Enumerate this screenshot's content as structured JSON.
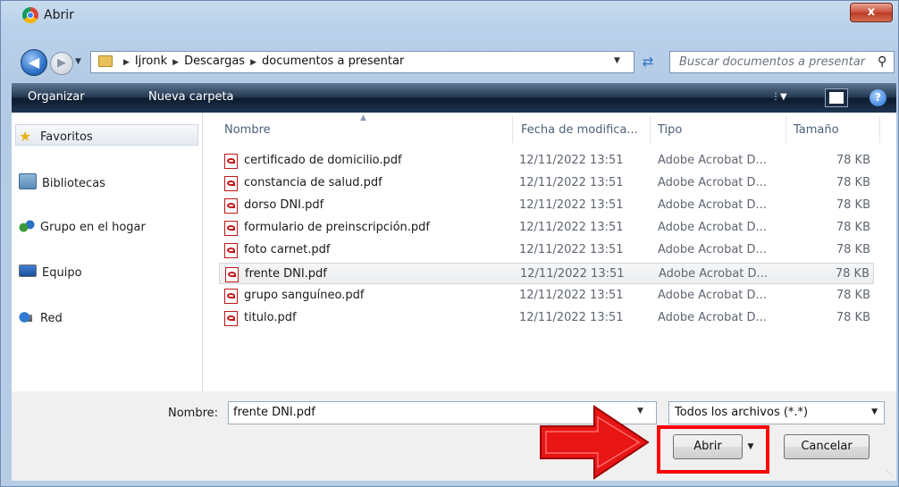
{
  "window": {
    "title": "Abrir",
    "close_label": "x"
  },
  "address": {
    "crumbs": [
      "Ijronk",
      "Descargas",
      "documentos a presentar"
    ],
    "search_placeholder": "Buscar documentos a presentar"
  },
  "toolbar": {
    "organize": "Organizar",
    "new_folder": "Nueva carpeta",
    "help": "?"
  },
  "sidebar": {
    "items": [
      {
        "label": "Favoritos",
        "icon": "star-icon"
      },
      {
        "label": "Bibliotecas",
        "icon": "library-icon"
      },
      {
        "label": "Grupo en el hogar",
        "icon": "homegroup-icon"
      },
      {
        "label": "Equipo",
        "icon": "computer-icon"
      },
      {
        "label": "Red",
        "icon": "network-icon"
      }
    ]
  },
  "columns": {
    "name": "Nombre",
    "date": "Fecha de modifica...",
    "type": "Tipo",
    "size": "Tamaño"
  },
  "files": [
    {
      "name": "certificado de domicilio.pdf",
      "date": "12/11/2022 13:51",
      "type": "Adobe Acrobat D...",
      "size": "78 KB"
    },
    {
      "name": "constancia de salud.pdf",
      "date": "12/11/2022 13:51",
      "type": "Adobe Acrobat D...",
      "size": "78 KB"
    },
    {
      "name": "dorso DNI.pdf",
      "date": "12/11/2022 13:51",
      "type": "Adobe Acrobat D...",
      "size": "78 KB"
    },
    {
      "name": "formulario de preinscripción.pdf",
      "date": "12/11/2022 13:51",
      "type": "Adobe Acrobat D...",
      "size": "78 KB"
    },
    {
      "name": "foto carnet.pdf",
      "date": "12/11/2022 13:51",
      "type": "Adobe Acrobat D...",
      "size": "78 KB"
    },
    {
      "name": "frente DNI.pdf",
      "date": "12/11/2022 13:51",
      "type": "Adobe Acrobat D...",
      "size": "78 KB"
    },
    {
      "name": "grupo sanguíneo.pdf",
      "date": "12/11/2022 13:51",
      "type": "Adobe Acrobat D...",
      "size": "78 KB"
    },
    {
      "name": "titulo.pdf",
      "date": "12/11/2022 13:51",
      "type": "Adobe Acrobat D...",
      "size": "78 KB"
    }
  ],
  "selected_index": 5,
  "footer": {
    "name_label": "Nombre:",
    "name_value": "frente DNI.pdf",
    "filter": "Todos los archivos (*.*)",
    "open_button": "Abrir",
    "cancel_button": "Cancelar"
  },
  "colors": {
    "annotation_red": "#ff0000",
    "selected_row": "#ebedef"
  }
}
